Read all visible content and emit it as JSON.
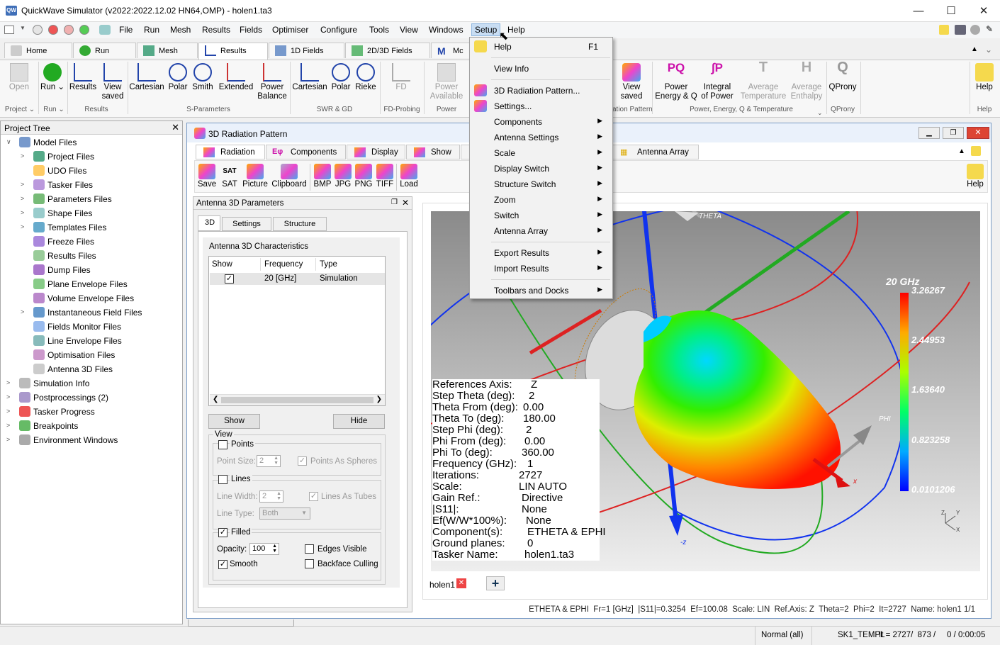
{
  "window": {
    "title": "QuickWave Simulator (v2022:2022.12.02 HN64,OMP) - holen1.ta3",
    "controls": [
      "—",
      "☐",
      "✕"
    ]
  },
  "menubar": [
    "File",
    "Run",
    "Mesh",
    "Results",
    "Fields",
    "Optimiser",
    "Configure",
    "Tools",
    "View",
    "Windows",
    "Setup",
    "Help"
  ],
  "ribbon_tabs": [
    "Home",
    "Run",
    "Mesh",
    "Results",
    "1D Fields",
    "2D/3D Fields",
    "Mc"
  ],
  "ribbon": {
    "buttons": {
      "open": "Open",
      "run": "Run",
      "results": "Results",
      "view_saved": "View\nsaved",
      "cartesian": "Cartesian",
      "polar": "Polar",
      "smith": "Smith",
      "extended": "Extended",
      "power_balance": "Power\nBalance",
      "cartesian2": "Cartesian",
      "polar2": "Polar",
      "rieke": "Rieke",
      "fd": "FD",
      "power_available": "Power\nAvailable",
      "view_saved2": "View\nsaved",
      "power_energy": "Power\nEnergy & Q",
      "integral_power": "Integral\nof Power",
      "avg_temp": "Average\nTemperature",
      "avg_enthalpy": "Average\nEnthalpy",
      "qprony": "QProny",
      "help": "Help"
    },
    "groups": {
      "project": "Project",
      "run": "Run",
      "results": "Results",
      "sparams": "S-Parameters",
      "swr": "SWR & GD",
      "fd_probing": "FD-Probing",
      "power": "Power",
      "radiation": "ation Pattern",
      "pe": "Power, Energy, Q & Temperature",
      "qprony": "QProny",
      "help": "Help"
    }
  },
  "project_tree": {
    "title": "Project Tree",
    "items": [
      {
        "label": "Model Files",
        "level": 0,
        "exp": "∨"
      },
      {
        "label": "Project Files",
        "level": 1,
        "exp": ">"
      },
      {
        "label": "UDO Files",
        "level": 1,
        "exp": ""
      },
      {
        "label": "Tasker Files",
        "level": 1,
        "exp": ">"
      },
      {
        "label": "Parameters Files",
        "level": 1,
        "exp": ">"
      },
      {
        "label": "Shape Files",
        "level": 1,
        "exp": ">"
      },
      {
        "label": "Templates Files",
        "level": 1,
        "exp": ">"
      },
      {
        "label": "Freeze Files",
        "level": 1,
        "exp": ""
      },
      {
        "label": "Results Files",
        "level": 1,
        "exp": ""
      },
      {
        "label": "Dump Files",
        "level": 1,
        "exp": ""
      },
      {
        "label": "Plane Envelope Files",
        "level": 1,
        "exp": ""
      },
      {
        "label": "Volume Envelope Files",
        "level": 1,
        "exp": ""
      },
      {
        "label": "Instantaneous Field Files",
        "level": 1,
        "exp": ">"
      },
      {
        "label": "Fields Monitor Files",
        "level": 1,
        "exp": ""
      },
      {
        "label": "Line Envelope Files",
        "level": 1,
        "exp": ""
      },
      {
        "label": "Optimisation Files",
        "level": 1,
        "exp": ""
      },
      {
        "label": "Antenna 3D Files",
        "level": 1,
        "exp": ""
      },
      {
        "label": "Simulation Info",
        "level": 0,
        "exp": ">"
      },
      {
        "label": "Postprocessings (2)",
        "level": 0,
        "exp": ">"
      },
      {
        "label": "Tasker Progress",
        "level": 0,
        "exp": ">"
      },
      {
        "label": "Breakpoints",
        "level": 0,
        "exp": ">"
      },
      {
        "label": "Environment Windows",
        "level": 0,
        "exp": ">"
      }
    ]
  },
  "rad_window": {
    "title": "3D Radiation Pattern",
    "tabs": [
      "Radiation",
      "Components",
      "Display",
      "Show",
      "Antenna Array"
    ],
    "toolbar": [
      "Save",
      "SAT",
      "Picture",
      "Clipboard",
      "BMP",
      "JPG",
      "PNG",
      "TIFF",
      "Load",
      "Help"
    ],
    "params_panel": {
      "title": "Antenna 3D Parameters",
      "tabs": [
        "3D",
        "Settings",
        "Structure"
      ],
      "group_title": "Antenna 3D Characteristics",
      "columns": [
        "Show",
        "Frequency",
        "Type"
      ],
      "rows": [
        {
          "show": true,
          "frequency": "20 [GHz]",
          "type": "Simulation"
        }
      ],
      "show_btn": "Show",
      "hide_btn": "Hide",
      "view_title": "View",
      "points": "Points",
      "point_size_label": "Point Size:",
      "point_size": "2",
      "points_as_spheres": "Points As Spheres",
      "lines": "Lines",
      "line_width_label": "Line Width:",
      "line_width": "2",
      "lines_as_tubes": "Lines As Tubes",
      "line_type_label": "Line Type:",
      "line_type": "Both",
      "filled": "Filled",
      "opacity_label": "Opacity:",
      "opacity": "100",
      "edges_visible": "Edges Visible",
      "smooth": "Smooth",
      "backface_culling": "Backface Culling"
    },
    "plot": {
      "axis_theta": "THETA",
      "axis_phi": "PHI",
      "axis_x": "x",
      "axis_z": "-z",
      "legend_title": "20 GHz",
      "legend_ticks": [
        "3.26267",
        "2.44953",
        "1.63640",
        "0.823258",
        "0.0101206"
      ],
      "info": [
        {
          "k": "References Axis:",
          "v": "Z"
        },
        {
          "k": "Step Theta (deg):",
          "v": "2"
        },
        {
          "k": "Theta From (deg):",
          "v": "0.00"
        },
        {
          "k": "Theta To (deg):",
          "v": "180.00"
        },
        {
          "k": "Step Phi (deg):",
          "v": "2"
        },
        {
          "k": "Phi From (deg):",
          "v": "0.00"
        },
        {
          "k": "Phi To (deg):",
          "v": "360.00"
        },
        {
          "k": "Frequency (GHz):",
          "v": "1"
        },
        {
          "k": "Iterations:",
          "v": "2727"
        },
        {
          "k": "Scale:",
          "v": "LIN AUTO"
        },
        {
          "k": "Gain Ref.:",
          "v": "Directive"
        },
        {
          "k": "|S11|:",
          "v": "None"
        },
        {
          "k": "Ef(W/W*100%):",
          "v": "None"
        },
        {
          "k": "Component(s):",
          "v": "ETHETA & EPHI"
        },
        {
          "k": "Ground planes:",
          "v": "0"
        },
        {
          "k": "Tasker Name:",
          "v": "holen1.ta3"
        }
      ],
      "tab_label": "holen1"
    },
    "status": "ETHETA & EPHI  Fr=1 [GHz]  |S11|=0.3254  Ef=100.08  Scale: LIN  Ref.Axis: Z  Theta=2  Phi=2  It=2727  Name: holen1 1/1"
  },
  "setup_menu": {
    "items": [
      {
        "label": "Help",
        "shortcut": "F1",
        "sub": false
      },
      {
        "sep": true
      },
      {
        "label": "View Info",
        "sub": false
      },
      {
        "sep": true
      },
      {
        "label": "3D Radiation Pattern...",
        "sub": false
      },
      {
        "label": "Settings...",
        "sub": false
      },
      {
        "label": "Components",
        "sub": true
      },
      {
        "label": "Antenna Settings",
        "sub": true
      },
      {
        "label": "Scale",
        "sub": true
      },
      {
        "label": "Display Switch",
        "sub": true
      },
      {
        "label": "Structure Switch",
        "sub": true
      },
      {
        "label": "Zoom",
        "sub": true
      },
      {
        "label": "Switch",
        "sub": true
      },
      {
        "label": "Antenna Array",
        "sub": true
      },
      {
        "sep": true
      },
      {
        "label": "Export Results",
        "sub": true
      },
      {
        "label": "Import Results",
        "sub": true
      },
      {
        "sep": true
      },
      {
        "label": "Toolbars and Docks",
        "sub": true
      }
    ]
  },
  "statusbar": {
    "mode": "Normal (all)",
    "template": "SK1_TEMPL",
    "iter": "It = 2727/  873 /",
    "time": "0 / 0:00:05"
  }
}
